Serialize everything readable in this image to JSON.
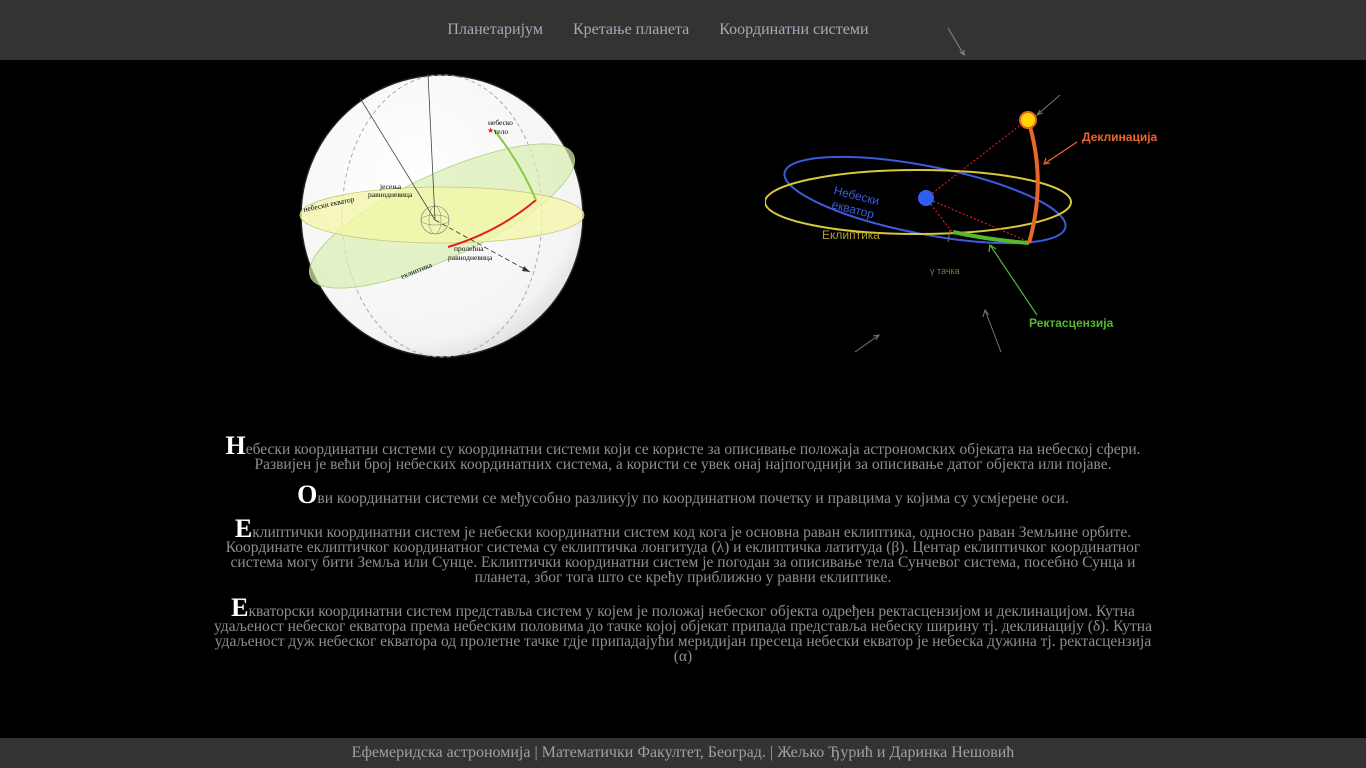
{
  "nav": {
    "items": [
      {
        "label": "Планетаријум"
      },
      {
        "label": "Кретање планета"
      },
      {
        "label": "Координатни системи"
      }
    ]
  },
  "left_figure": {
    "labels": {
      "celestial_body": "небеско",
      "celestial_body_2": "тело",
      "celestial_equator": "небески екватор",
      "autumn_equinox": "јесења",
      "autumn_equinox_2": "равнодневица",
      "spring_equinox": "пролећна",
      "spring_equinox_2": "равнодневица",
      "ecliptic": "еклиптика"
    }
  },
  "right_figure": {
    "labels": {
      "declination": "Деклинација",
      "celestial_equator": "Небески",
      "celestial_equator_2": "екватор",
      "ecliptic": "Еклиптика",
      "gamma_point": "γ тачка",
      "right_ascension": "Ректасцензија"
    },
    "colors": {
      "declination": "#e8662a",
      "equator": "#3b5bdb",
      "ecliptic": "#d8c93a",
      "right_ascension": "#55b82e",
      "sun": "#ffd400",
      "earth": "#2f5ef0"
    }
  },
  "content": {
    "paragraphs": [
      {
        "initial": "Н",
        "text": "ебески координатни системи су координатни системи који се користе за описивање положаја астрономских објеката на небеској сфери. Развијен је већи број небеских координатних система, а користи се увек онај најпогоднији за описивање датог објекта или појаве."
      },
      {
        "initial": "О",
        "text": "ви координатни системи се међусобно разликују по координатном почетку и правцима у којима су усмјерене оси."
      },
      {
        "initial": "Е",
        "text": "клиптички координатни систем је небески координатни систем код кога је основна раван еклиптика, односно раван Земљине орбите. Координате еклиптичког координатног система су еклиптичка лонгитуда (λ) и еклиптичка латитуда (β). Центар еклиптичког координатног система могу бити Земља или Сунце. Еклиптички координатни систем је погодан за описивање тела Сунчевог система, посебно Сунца и планета, због тога што се крећу приближно у равни еклиптике."
      },
      {
        "initial": "Е",
        "text": "кваторски координатни систем представља систем у којем је положај небеског објекта одређен ректасцензијом и деклинацијом. Кутна удаљеност небеског екватора према небеским половима до тачке којој објекат припада представља небеску ширину тј. деклинацију (δ). Кутна удаљеност дуж небеског екватора од пролетне тачке гдје припадајући меридијан пресеца небески екватор је небеска дужина тј. ректасцензија (α)"
      }
    ]
  },
  "footer": {
    "text": "Ефемеридска астрономија | Математички Факултет, Београд. | Жељко Ђурић и Даринка Нешовић"
  }
}
